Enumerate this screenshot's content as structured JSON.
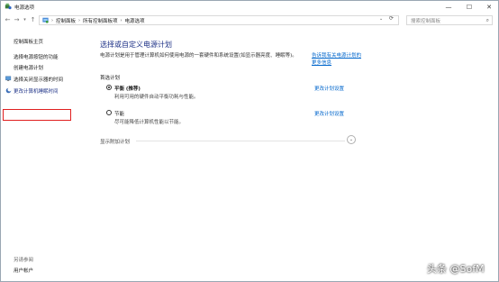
{
  "window": {
    "title": "电源选项",
    "minimize_glyph": "—",
    "maximize_glyph": "☐",
    "close_glyph": "✕",
    "app_icon": "power-options-icon"
  },
  "address_bar": {
    "back_glyph": "←",
    "forward_glyph": "→",
    "recent_glyph": "▾",
    "up_glyph": "↑",
    "crumbs": [
      "控制面板",
      "所有控制面板项",
      "电源选项"
    ],
    "separator": "›",
    "dropdown_glyph": "⌄",
    "refresh_glyph": "⟳",
    "search_placeholder": "搜索控制面板",
    "search_glyph": "⌕"
  },
  "sidebar": {
    "home": "控制面板主页",
    "items": [
      "选择电源按钮的功能",
      "创建电源计划",
      "选择关闭显示器的时间",
      "更改计算机睡眠时间"
    ],
    "see_also_header": "另请参阅",
    "see_also_items": [
      "用户帐户"
    ]
  },
  "main": {
    "title": "选择或自定义电源计划",
    "description": "电源计划是用于管理计算机如何使用电源的一套硬件和系统设置(如显示器亮度、睡眠等)。",
    "description_link": "告诉我有关电源计划的更多信息",
    "section_label": "首选计划",
    "plans": [
      {
        "name": "平衡 (推荐)",
        "description": "利用可用的硬件自动平衡功耗与性能。",
        "change_link": "更改计划设置",
        "selected": true
      },
      {
        "name": "节能",
        "description": "尽可能降低计算机性能以节能。",
        "change_link": "更改计划设置",
        "selected": false
      }
    ],
    "extra_plans": "显示附加计划",
    "expand_glyph": "⌄"
  },
  "watermark": "头条 @SofM",
  "colors": {
    "title_blue": "#1e3287",
    "link_blue": "#0066cc",
    "highlight_red": "#e02020"
  }
}
